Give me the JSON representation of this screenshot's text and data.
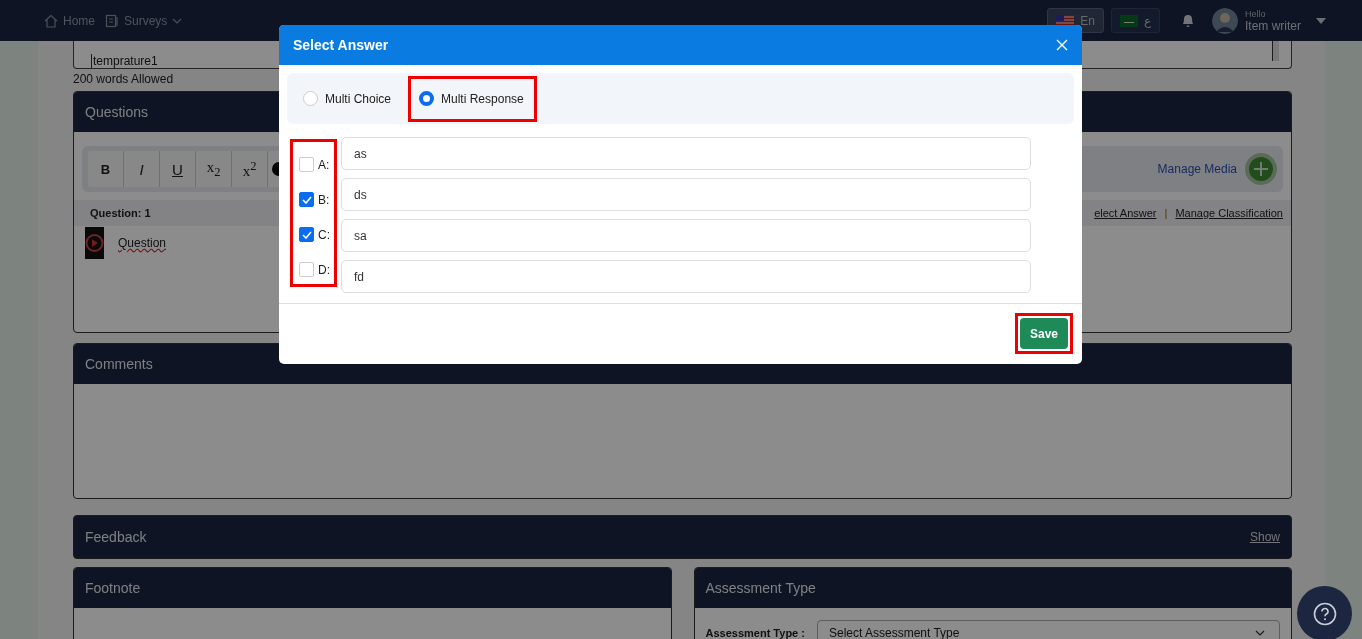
{
  "header": {
    "nav": [
      {
        "label": "Home",
        "kind": "home"
      },
      {
        "label": "Surveys",
        "kind": "surveys"
      }
    ],
    "languages": [
      {
        "label": "En",
        "kind": "us",
        "selected": true
      },
      {
        "label": "ع",
        "kind": "sa",
        "selected": false
      }
    ],
    "greeting": "Hello",
    "user": "Item writer"
  },
  "editor": {
    "text": "temprature1",
    "word_limit": "200 words Allowed"
  },
  "questions": {
    "title": "Questions",
    "toolbar": [
      {
        "label": "B",
        "kind": "bold"
      },
      {
        "label": "I",
        "kind": "italic"
      },
      {
        "label": "U",
        "kind": "underline"
      },
      {
        "label": "x$_{2}$",
        "kind": "plain"
      },
      {
        "label": "x$^{2}$",
        "kind": "plain"
      }
    ],
    "manage_media": "Manage Media",
    "question_label": "Question: 1",
    "links": [
      "elect Answer",
      "Manage Classification"
    ],
    "link_separator": "|",
    "question_item": "Question"
  },
  "comments": {
    "title": "Comments"
  },
  "feedback": {
    "title": "Feedback",
    "action": "Show"
  },
  "footnote": {
    "title": "Footnote"
  },
  "assessment": {
    "title": "Assessment Type",
    "label": "Assessment Type :",
    "select": "Select Assessment Type"
  },
  "modal": {
    "title": "Select Answer",
    "modes": [
      {
        "label": "Multi Choice",
        "selected": false,
        "highlighted": false
      },
      {
        "label": "Multi Response",
        "selected": true,
        "highlighted": true
      }
    ],
    "options_highlighted": true,
    "options": [
      {
        "letter": "A:",
        "value": "as",
        "checked": false
      },
      {
        "letter": "B:",
        "value": "ds",
        "checked": true
      },
      {
        "letter": "C:",
        "value": "sa",
        "checked": true
      },
      {
        "letter": "D:",
        "value": "fd",
        "checked": false
      }
    ],
    "save": {
      "label": "Save",
      "highlighted": true
    }
  }
}
